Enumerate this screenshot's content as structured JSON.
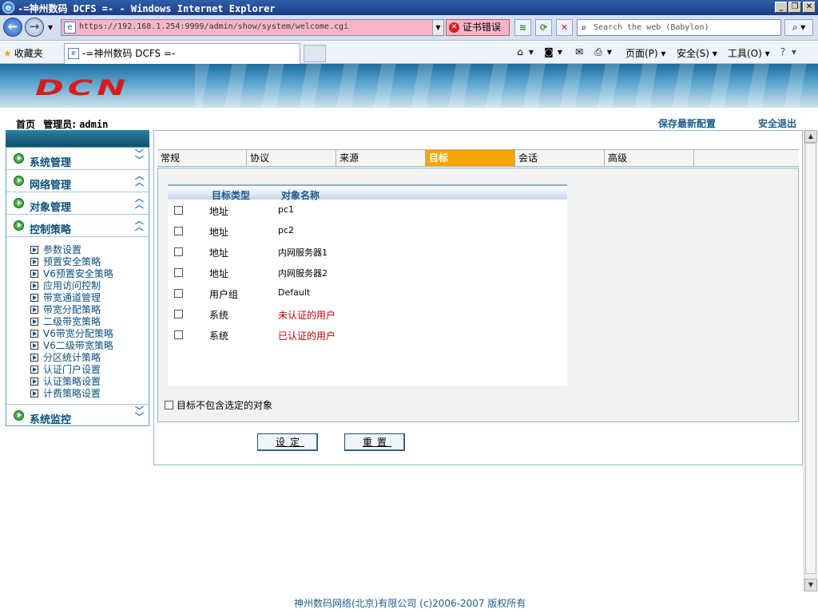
{
  "window": {
    "title": "-=神州数码 DCFS =- - Windows Internet Explorer",
    "buttons": [
      "_",
      "❐",
      "✕"
    ]
  },
  "browser": {
    "url": "https://192.168.1.254:9999/admin/show/system/welcome.cgi",
    "cert_error": "证书错误",
    "search_placeholder": "Search the web (Babylon)",
    "favorites": "收藏夹",
    "tab_title": "-=神州数码 DCFS =-",
    "commands": {
      "page": "页面(P)",
      "safety": "安全(S)",
      "tools": "工具(O)"
    }
  },
  "banner": {
    "logo": "DCN"
  },
  "header": {
    "home": "首页",
    "admin_label": "管理员:",
    "admin_name": "admin",
    "save_config": "保存最新配置",
    "logout": "安全退出"
  },
  "sidebar": {
    "menus": [
      {
        "label": "系统管理",
        "state": "collapsed"
      },
      {
        "label": "网络管理",
        "state": "expanded"
      },
      {
        "label": "对象管理",
        "state": "expanded"
      },
      {
        "label": "控制策略",
        "state": "expanded"
      },
      {
        "label": "系统监控",
        "state": "collapsed"
      }
    ],
    "policy_items": [
      "参数设置",
      "预置安全策略",
      "V6预置安全策略",
      "应用访问控制",
      "带宽通道管理",
      "带宽分配策略",
      "二级带宽策略",
      "V6带宽分配策略",
      "V6二级带宽策略",
      "分区统计策略",
      "认证门户设置",
      "认证策略设置",
      "计费策略设置"
    ]
  },
  "content": {
    "tabs": [
      "常规",
      "协议",
      "来源",
      "目标",
      "会话",
      "高级"
    ],
    "active_tab": "目标",
    "table": {
      "headers": [
        "目标类型",
        "对象名称"
      ],
      "rows": [
        {
          "type": "地址",
          "name": "pc1",
          "checked": false
        },
        {
          "type": "地址",
          "name": "pc2",
          "checked": false
        },
        {
          "type": "地址",
          "name": "内网服务器1",
          "checked": false
        },
        {
          "type": "地址",
          "name": "内网服务器2",
          "checked": false
        },
        {
          "type": "用户组",
          "name": "Default",
          "checked": false
        },
        {
          "type": "系统",
          "name": "未认证的用户",
          "checked": false
        },
        {
          "type": "系统",
          "name": "已认证的用户",
          "checked": false
        }
      ]
    },
    "exclude_label": "目标不包含选定的对象",
    "set_button": "设定",
    "reset_button": "重置"
  },
  "footer": {
    "copyright": "神州数码网络(北京)有限公司 (c)2006-2007 版权所有"
  },
  "colors": {
    "active_tab": "#f5a400",
    "link": "#1b5e8e",
    "special_name": "#c00000",
    "logo": "#d71c1c"
  }
}
